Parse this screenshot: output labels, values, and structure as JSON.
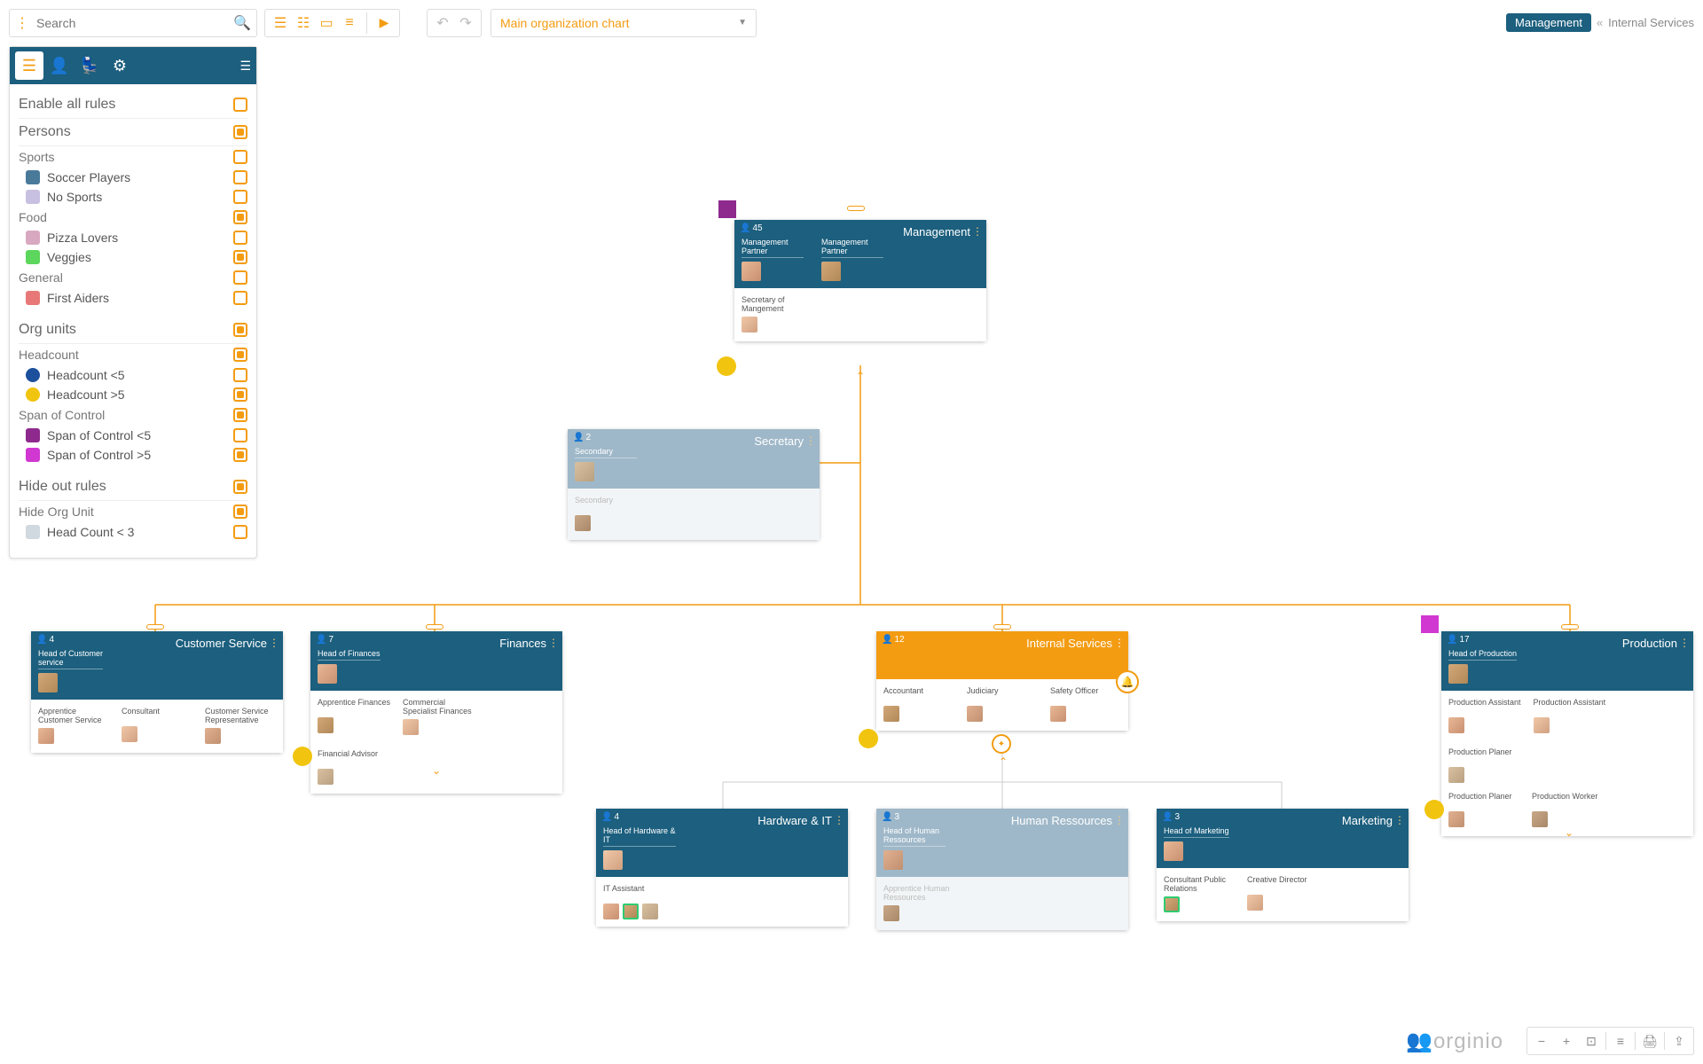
{
  "toolbar": {
    "search_placeholder": "Search",
    "chart_select": "Main organization chart"
  },
  "breadcrumb": {
    "active": "Management",
    "sep": "«",
    "inactive": "Internal Services"
  },
  "sidebar": {
    "enable_all": "Enable all rules",
    "persons": {
      "title": "Persons",
      "sports": "Sports",
      "soccer": "Soccer Players",
      "nosports": "No Sports",
      "food": "Food",
      "pizza": "Pizza Lovers",
      "veggies": "Veggies",
      "general": "General",
      "firstaiders": "First Aiders"
    },
    "orgunits": {
      "title": "Org units",
      "headcount": "Headcount",
      "hc_lt5": "Headcount <5",
      "hc_gt5": "Headcount >5",
      "span": "Span of Control",
      "span_lt5": "Span of Control <5",
      "span_gt5": "Span of Control >5"
    },
    "hideout": {
      "title": "Hide out rules",
      "hideorg": "Hide Org Unit",
      "hc_lt3": "Head Count < 3"
    }
  },
  "cards": {
    "management": {
      "count": "45",
      "title": "Management",
      "lead1": "Management\nPartner",
      "lead2": "Management\nPartner",
      "sec": "Secretary of\nMangement"
    },
    "secretary": {
      "count": "2",
      "title": "Secretary",
      "lead1": "Secondary",
      "p1": "Secondary"
    },
    "customer": {
      "count": "4",
      "title": "Customer Service",
      "lead1": "Head of Customer\nservice",
      "p1": "Apprentice\nCustomer Service",
      "p2": "Consultant",
      "p3": "Customer Service\nRepresentative"
    },
    "finances": {
      "count": "7",
      "title": "Finances",
      "lead1": "Head of Finances",
      "p1": "Apprentice Finances",
      "p2": "Commercial\nSpecialist Finances",
      "p3": "Financial Advisor"
    },
    "internal": {
      "count": "12",
      "title": "Internal Services",
      "p1": "Accountant",
      "p2": "Judiciary",
      "p3": "Safety Officer"
    },
    "production": {
      "count": "17",
      "title": "Production",
      "lead1": "Head of Production",
      "p1": "Production Assistant",
      "p2": "Production Assistant",
      "p3": "Production Planer",
      "p4": "Production Planer",
      "p5": "Production Worker"
    },
    "hardware": {
      "count": "4",
      "title": "Hardware & IT",
      "lead1": "Head of Hardware &\nIT",
      "p1": "IT Assistant"
    },
    "hr": {
      "count": "3",
      "title": "Human Ressources",
      "lead1": "Head of Human\nRessources",
      "p1": "Apprentice Human\nRessources"
    },
    "marketing": {
      "count": "3",
      "title": "Marketing",
      "lead1": "Head of Marketing",
      "p1": "Consultant Public\nRelations",
      "p2": "Creative Director"
    }
  },
  "logo": "orginio"
}
